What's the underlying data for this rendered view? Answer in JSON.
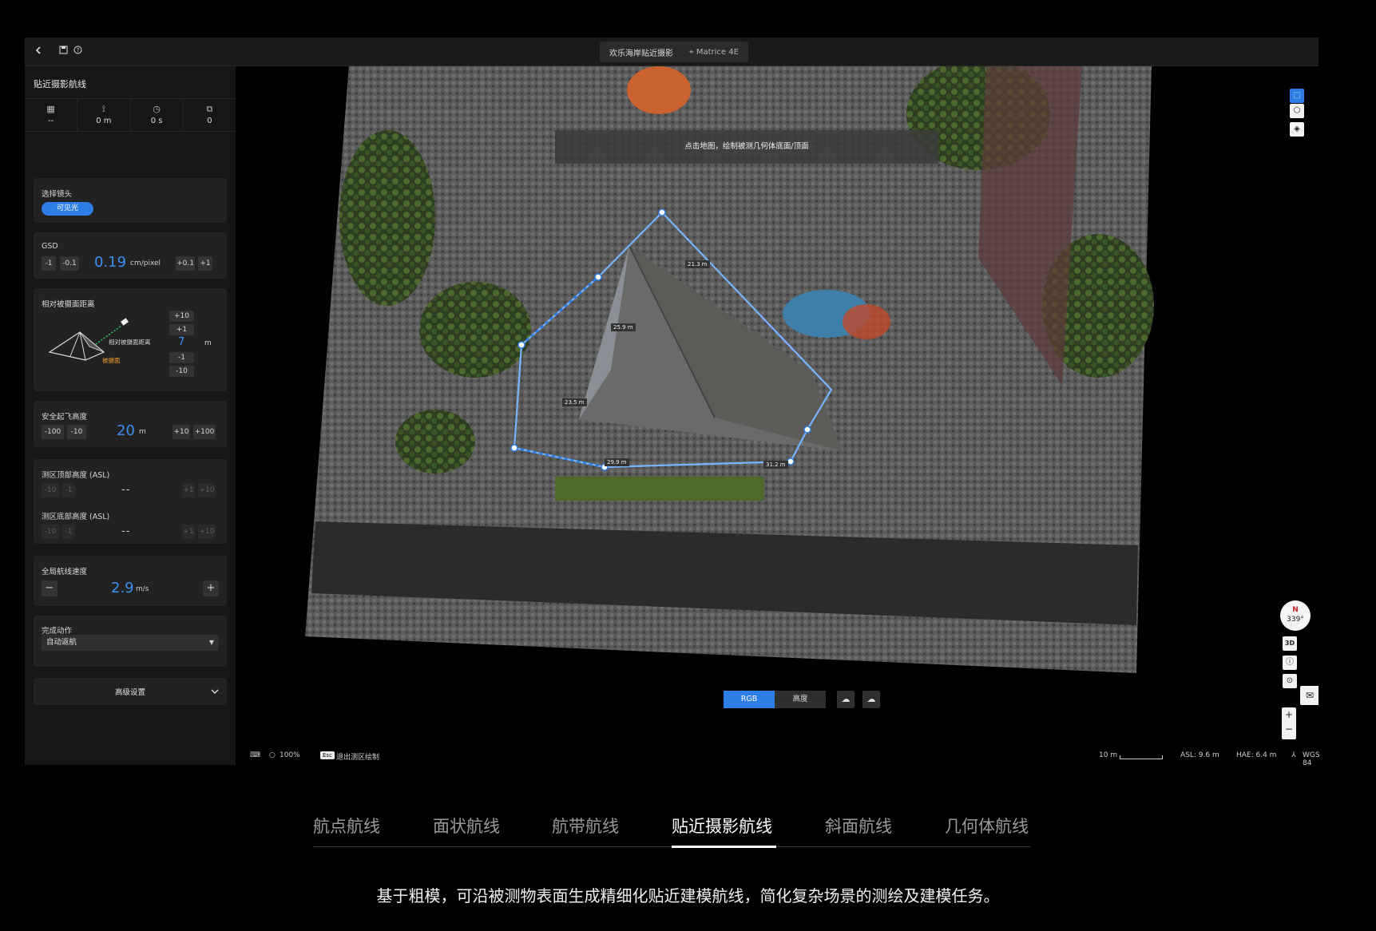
{
  "topbar": {
    "back_icon": "chevron-left-icon",
    "save_icon": "save-icon",
    "help_icon": "help-circle-icon",
    "mission_name": "欢乐海岸贴近摄影",
    "drone_model": "Matrice 4E"
  },
  "sidebar": {
    "title": "贴近摄影航线",
    "stats": [
      {
        "icon": "area-icon",
        "value": "--"
      },
      {
        "icon": "distance-icon",
        "value": "0 m"
      },
      {
        "icon": "clock-icon",
        "value": "0 s"
      },
      {
        "icon": "photo-icon",
        "value": "0"
      }
    ],
    "lens": {
      "label": "选择镜头",
      "option": "可见光"
    },
    "gsd": {
      "label": "GSD",
      "minus1": "-1",
      "minus01": "-0.1",
      "value": "0.19",
      "unit": "cm/pixel",
      "plus01": "+0.1",
      "plus1": "+1"
    },
    "distance": {
      "label": "相对被摄面距离",
      "plus10": "+10",
      "plus1": "+1",
      "value": "7",
      "unit": "m",
      "minus1": "-1",
      "minus10": "-10",
      "diagram_label": "相对被摄面距离",
      "surface_label": "被摄面"
    },
    "takeoff": {
      "label": "安全起飞高度",
      "minus100": "-100",
      "minus10": "-10",
      "value": "20",
      "unit": "m",
      "plus10": "+10",
      "plus100": "+100"
    },
    "top_alt": {
      "label": "测区顶部高度 (ASL)",
      "minus10": "-10",
      "minus1": "-1",
      "value": "--",
      "plus1": "+1",
      "plus10": "+10"
    },
    "bottom_alt": {
      "label": "测区底部高度 (ASL)",
      "minus10": "-10",
      "minus1": "-1",
      "value": "--",
      "plus1": "+1",
      "plus10": "+10"
    },
    "speed": {
      "label": "全局航线速度",
      "minus": "−",
      "value": "2.9",
      "unit": "m/s",
      "plus": "+"
    },
    "finish": {
      "label": "完成动作",
      "value": "自动返航"
    },
    "advanced": {
      "label": "高级设置"
    }
  },
  "map": {
    "hint": "点击地图，绘制被测几何体底面/顶面",
    "segment_labels": [
      "21.3 m",
      "25.9 m",
      "23.5 m",
      "29.9 m",
      "31.2 m"
    ],
    "compass": {
      "n": "N",
      "heading": "339°"
    },
    "view_3d": "3D",
    "modes": {
      "rgb": "RGB",
      "height": "高度"
    },
    "status": {
      "zoom": "100%",
      "esc_key": "Esc",
      "exit_label": "退出测区绘制",
      "scale": "10 m",
      "asl": "ASL: 9.6 m",
      "hae": "HAE: 6.4 m",
      "crs": "WGS 84"
    }
  },
  "tabs": {
    "items": [
      "航点航线",
      "面状航线",
      "航带航线",
      "贴近摄影航线",
      "斜面航线",
      "几何体航线"
    ],
    "active_index": 3
  },
  "caption": "基于粗模，可沿被测物表面生成精细化贴近建模航线，简化复杂场景的测绘及建模任务。",
  "colors": {
    "accent": "#2d7ee6",
    "panel": "#222222",
    "background": "#000000"
  }
}
